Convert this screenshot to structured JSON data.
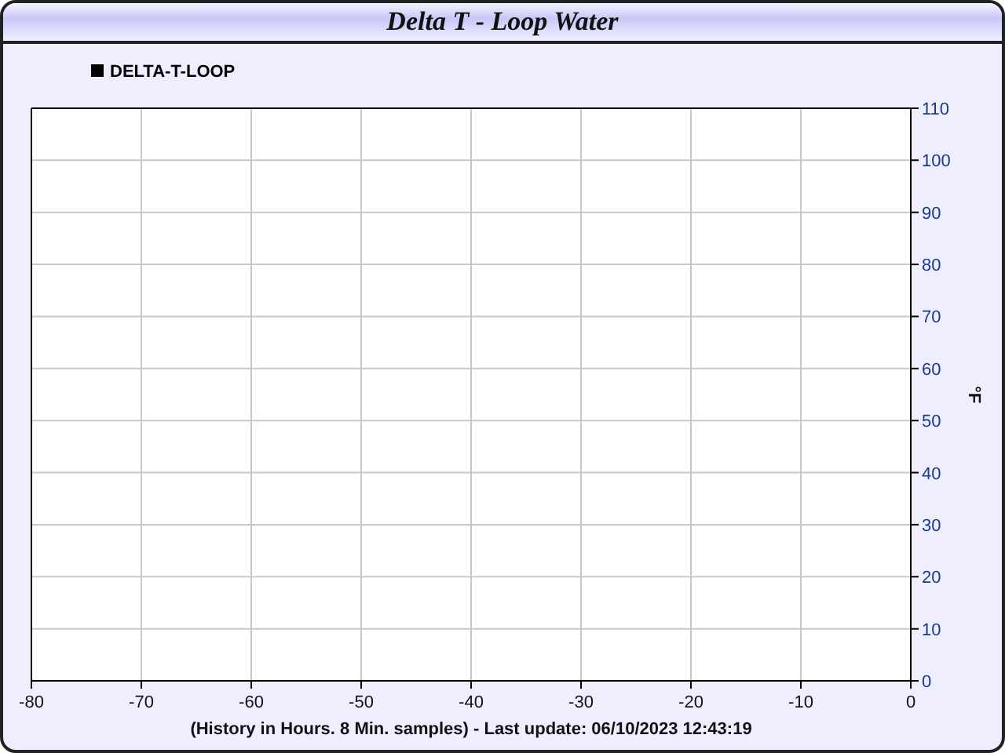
{
  "window": {
    "title": "Delta T - Loop Water"
  },
  "chart": {
    "chart_data": {
      "type": "line",
      "xlabel": "(History in Hours. 8 Min. samples) - Last update: 06/10/2023 12:43:19",
      "ylabel": "°F",
      "grid": true,
      "categories": [
        "-80",
        "-70",
        "-60",
        "-50",
        "-40",
        "-30",
        "-20",
        "-10",
        "0"
      ],
      "ylim": [
        0,
        110
      ],
      "yticks": [
        0,
        10,
        20,
        30,
        40,
        50,
        60,
        70,
        80,
        90,
        100,
        110
      ],
      "series": [
        {
          "name": "DELTA-T-LOOP",
          "color": "#000000",
          "values": [
            null,
            null,
            null,
            null,
            null,
            null,
            null,
            null,
            null
          ]
        }
      ]
    }
  }
}
